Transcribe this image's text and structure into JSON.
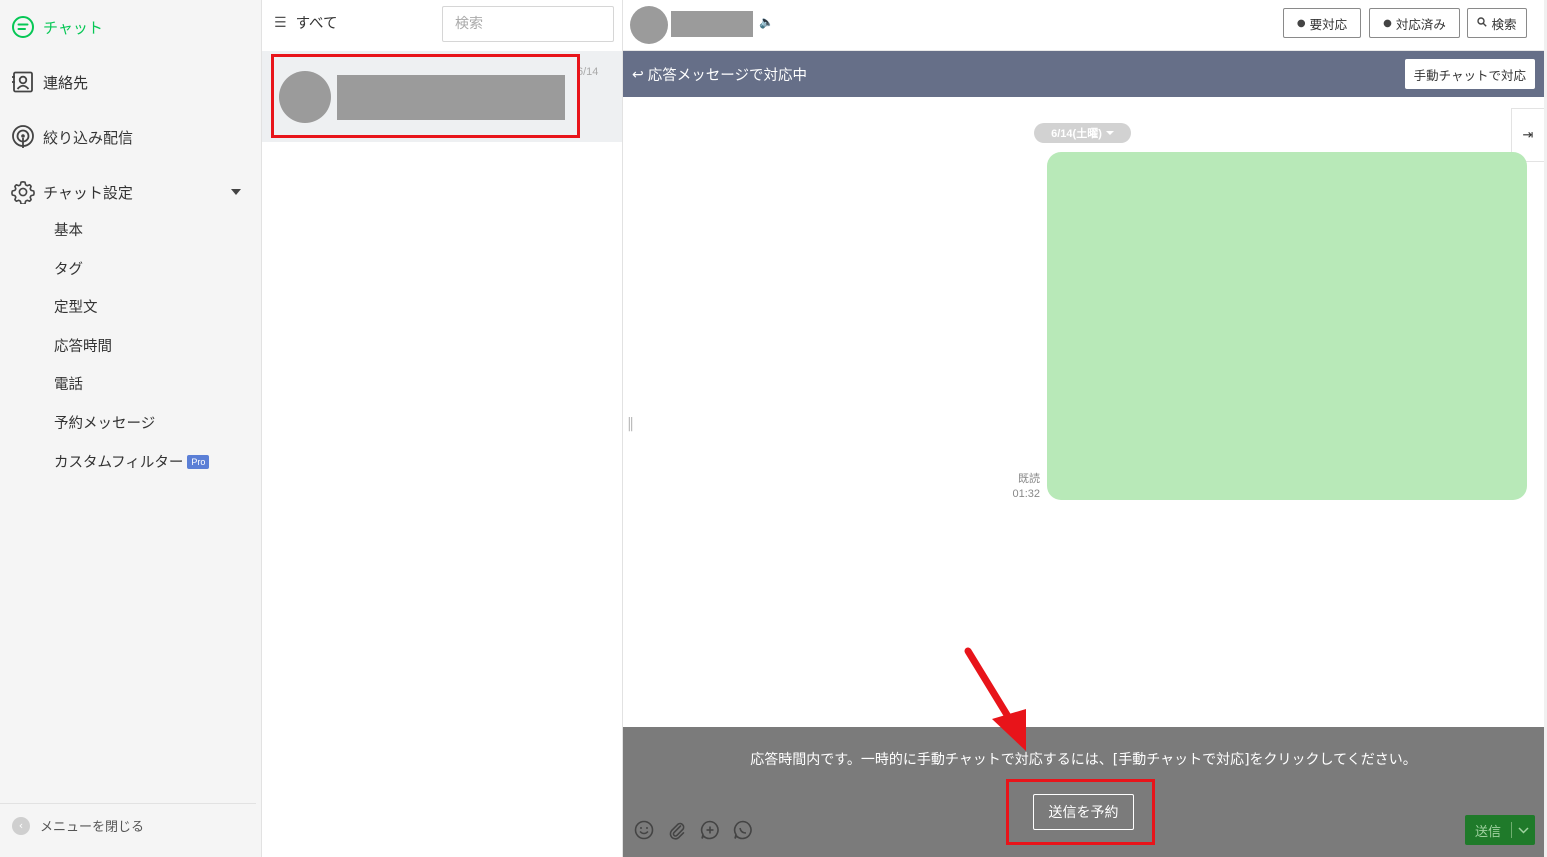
{
  "sidebar": {
    "nav": [
      {
        "label": "チャット",
        "icon": "chat-bubble-icon",
        "active": true
      },
      {
        "label": "連絡先",
        "icon": "contacts-icon"
      },
      {
        "label": "絞り込み配信",
        "icon": "broadcast-icon"
      },
      {
        "label": "チャット設定",
        "icon": "gear-icon"
      }
    ],
    "settings_items": [
      "基本",
      "タグ",
      "定型文",
      "応答時間",
      "電話",
      "予約メッセージ",
      "カスタムフィルター"
    ],
    "pro_badge": "Pro",
    "close_menu_label": "メニューを閉じる"
  },
  "chat_list": {
    "filter_label": "すべて",
    "search_placeholder": "検索",
    "items": [
      {
        "date": "6/14"
      }
    ]
  },
  "header": {
    "buttons": [
      {
        "label": "要対応",
        "icon": "speech-bubble-icon"
      },
      {
        "label": "対応済み",
        "icon": "speech-bubble-check-icon"
      },
      {
        "label": "検索",
        "icon": "search-icon"
      }
    ]
  },
  "banner": {
    "title": "応答メッセージで対応中",
    "manual_button": "手動チャットで対応"
  },
  "messages": {
    "date_pill": "6/14(土曜)",
    "read_label": "既読",
    "time": "01:32"
  },
  "bottom": {
    "notice": "応答時間内です。一時的に手動チャットで対応するには、[手動チャットで対応]をクリックしてください。",
    "schedule_button": "送信を予約",
    "send_button": "送信",
    "icons": [
      "emoji-icon",
      "attach-icon",
      "add-icon",
      "chat-template-icon"
    ]
  },
  "colors": {
    "accent_green": "#06c755",
    "banner_bg": "#666f88",
    "highlight_red": "#e8141a",
    "bubble_green": "#b8e9b8"
  }
}
